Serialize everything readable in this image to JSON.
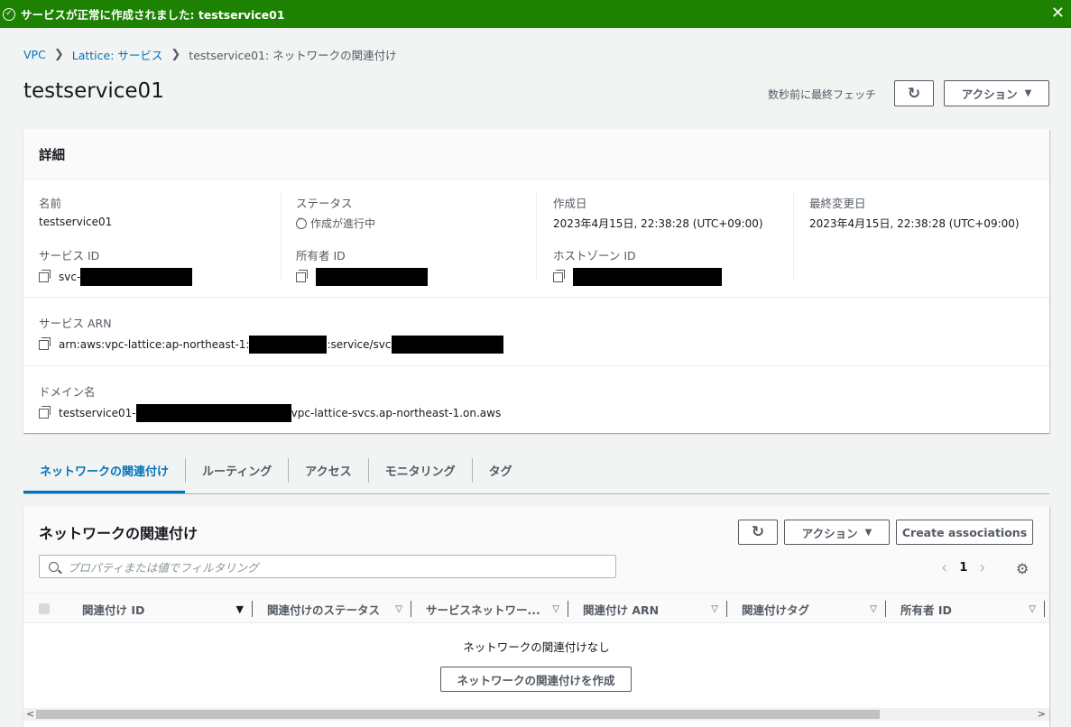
{
  "flash": {
    "message": "サービスが正常に作成されました: testservice01",
    "close": "✕"
  },
  "breadcrumb": {
    "items": [
      "VPC",
      "Lattice: サービス",
      "testservice01: ネットワークの関連付け"
    ],
    "sep": "❯"
  },
  "header": {
    "title": "testservice01",
    "fetched": "数秒前に最終フェッチ",
    "refresh_glyph": "↻",
    "actions_label": "アクション",
    "dropdown_glyph": "▼"
  },
  "details": {
    "title": "詳細",
    "name_label": "名前",
    "name_value": "testservice01",
    "status_label": "ステータス",
    "status_value": "作成が進行中",
    "created_label": "作成日",
    "created_value": "2023年4月15日, 22:38:28 (UTC+09:00)",
    "modified_label": "最終変更日",
    "modified_value": "2023年4月15日, 22:38:28 (UTC+09:00)",
    "service_id_label": "サービス ID",
    "service_id_prefix": "svc-",
    "owner_id_label": "所有者 ID",
    "hosted_zone_label": "ホストゾーン ID",
    "arn_label": "サービス ARN",
    "arn_part1": "arn:aws:vpc-lattice:ap-northeast-1:",
    "arn_part2": ":service/svc",
    "domain_label": "ドメイン名",
    "domain_part1": "testservice01-",
    "domain_part2": "vpc-lattice-svcs.ap-northeast-1.on.aws"
  },
  "tabs": [
    "ネットワークの関連付け",
    "ルーティング",
    "アクセス",
    "モニタリング",
    "タグ"
  ],
  "associations": {
    "title": "ネットワークの関連付け",
    "refresh_glyph": "↻",
    "actions_label": "アクション",
    "create_label": "Create associations",
    "search_placeholder": "プロパティまたは値でフィルタリング",
    "page": "1",
    "prev": "‹",
    "next": "›",
    "settings_glyph": "⚙",
    "columns": [
      "関連付け ID",
      "関連付けのステータス",
      "サービスネットワー...",
      "関連付け ARN",
      "関連付けタグ",
      "所有者 ID"
    ],
    "sort_active": "▼",
    "sort_glyph": "▽",
    "empty_text": "ネットワークの関連付けなし",
    "empty_button": "ネットワークの関連付けを作成",
    "scroll_left": "<",
    "scroll_right": ">"
  },
  "colors": {
    "success": "#1d8102",
    "link": "#0073bb",
    "text": "#16191f",
    "muted": "#545b64",
    "background": "#f2f3f3"
  }
}
